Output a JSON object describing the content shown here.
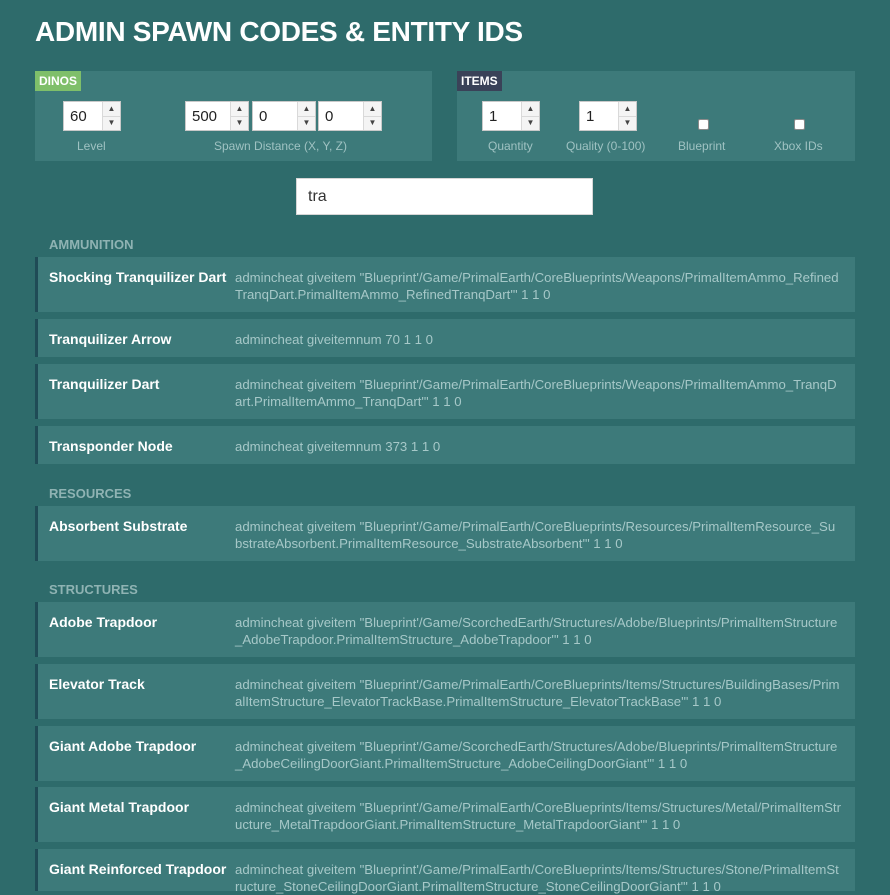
{
  "title": "ADMIN SPAWN CODES & ENTITY IDS",
  "dinos": {
    "tag": "DINOS",
    "level": "60",
    "level_label": "Level",
    "spawn_x": "500",
    "spawn_y": "0",
    "spawn_z": "0",
    "spawn_label": "Spawn Distance (X, Y, Z)"
  },
  "items": {
    "tag": "ITEMS",
    "quantity": "1",
    "quantity_label": "Quantity",
    "quality": "1",
    "quality_label": "Quality (0-100)",
    "blueprint_label": "Blueprint",
    "xbox_label": "Xbox IDs"
  },
  "search": {
    "value": "tra"
  },
  "sections": [
    {
      "heading": "AMMUNITION",
      "rows": [
        {
          "name": "Shocking Tranquilizer Dart",
          "code": "admincheat giveitem \"Blueprint'/Game/PrimalEarth/CoreBlueprints/Weapons/PrimalItemAmmo_RefinedTranqDart.PrimalItemAmmo_RefinedTranqDart'\" 1 1 0"
        },
        {
          "name": "Tranquilizer Arrow",
          "code": "admincheat giveitemnum 70 1 1 0"
        },
        {
          "name": "Tranquilizer Dart",
          "code": "admincheat giveitem \"Blueprint'/Game/PrimalEarth/CoreBlueprints/Weapons/PrimalItemAmmo_TranqDart.PrimalItemAmmo_TranqDart'\" 1 1 0"
        },
        {
          "name": "Transponder Node",
          "code": "admincheat giveitemnum 373 1 1 0"
        }
      ]
    },
    {
      "heading": "RESOURCES",
      "rows": [
        {
          "name": "Absorbent Substrate",
          "code": "admincheat giveitem \"Blueprint'/Game/PrimalEarth/CoreBlueprints/Resources/PrimalItemResource_SubstrateAbsorbent.PrimalItemResource_SubstrateAbsorbent'\" 1 1 0"
        }
      ]
    },
    {
      "heading": "STRUCTURES",
      "rows": [
        {
          "name": "Adobe Trapdoor",
          "code": "admincheat giveitem \"Blueprint'/Game/ScorchedEarth/Structures/Adobe/Blueprints/PrimalItemStructure_AdobeTrapdoor.PrimalItemStructure_AdobeTrapdoor'\" 1 1 0"
        },
        {
          "name": "Elevator Track",
          "code": "admincheat giveitem \"Blueprint'/Game/PrimalEarth/CoreBlueprints/Items/Structures/BuildingBases/PrimalItemStructure_ElevatorTrackBase.PrimalItemStructure_ElevatorTrackBase'\" 1 1 0"
        },
        {
          "name": "Giant Adobe Trapdoor",
          "code": "admincheat giveitem \"Blueprint'/Game/ScorchedEarth/Structures/Adobe/Blueprints/PrimalItemStructure_AdobeCeilingDoorGiant.PrimalItemStructure_AdobeCeilingDoorGiant'\" 1 1 0"
        },
        {
          "name": "Giant Metal Trapdoor",
          "code": "admincheat giveitem \"Blueprint'/Game/PrimalEarth/CoreBlueprints/Items/Structures/Metal/PrimalItemStructure_MetalTrapdoorGiant.PrimalItemStructure_MetalTrapdoorGiant'\" 1 1 0"
        },
        {
          "name": "Giant Reinforced Trapdoor",
          "code": "admincheat giveitem \"Blueprint'/Game/PrimalEarth/CoreBlueprints/Items/Structures/Stone/PrimalItemStructure_StoneCeilingDoorGiant.PrimalItemStructure_StoneCeilingDoorGiant'\" 1 1 0"
        }
      ]
    }
  ],
  "colors": {
    "background": "#2e6b6b",
    "panel": "#3d7a7a",
    "dinos_tag": "#7fbf6a",
    "items_tag": "#3a4258",
    "row_accent": "#1f4b56"
  }
}
